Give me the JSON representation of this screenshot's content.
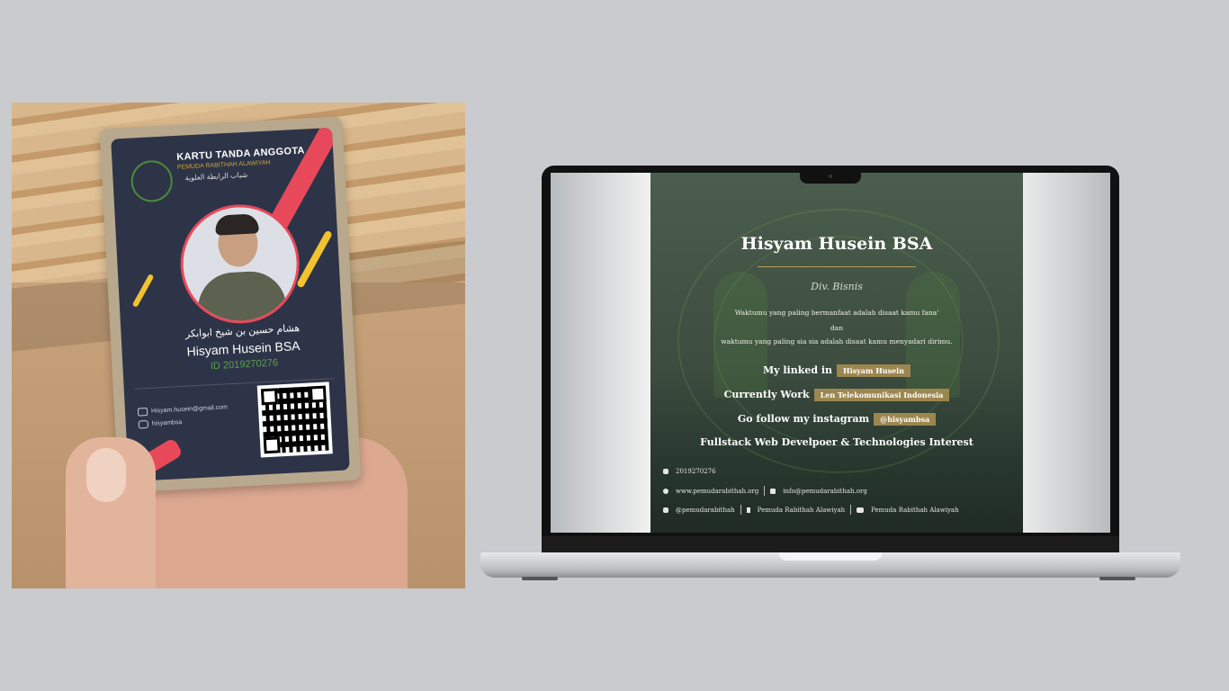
{
  "photo": {
    "card": {
      "title": "KARTU TANDA ANGGOTA",
      "org_latin": "PEMUDA RABITHAH ALAWIYAH",
      "org_arabic": "شباب الرابطة العلوية",
      "arabic_name": "هشام حسين بن شيخ ابوابكر",
      "name": "Hisyam Husein BSA",
      "id": "ID 2019270276",
      "email": "Hisyam.husein@gmail.com",
      "instagram": "hisyambsa"
    }
  },
  "page": {
    "name": "Hisyam Husein BSA",
    "division": "Div. Bisnis",
    "quote_line1": "Waktumu yang paling bermanfaat adalah disaat kamu fana'",
    "quote_and": "dan",
    "quote_line2": "waktumu yang paling sia sia adalah disaat kamu menyadari dirimu.",
    "linkedin_label": "My linked in",
    "linkedin_value": "Hisyam Husein",
    "work_label": "Currently Work",
    "work_value": "Len Telekomunikasi Indonesia",
    "instagram_label": "Go follow my instagram",
    "instagram_value": "@hisyambsa",
    "interest": "Fullstack Web Develpoer & Technologies Interest",
    "footer": {
      "member_id": "2019270276",
      "website": "www.pemudarabithah.org",
      "email": "info@pemudarabithah.org",
      "instagram": "@pemudarabithah",
      "facebook": "Pemuda Rabithah Alawiyah",
      "youtube": "Pemuda Rabithah Alawiyah"
    }
  },
  "colors": {
    "background": "#c9cbcf",
    "page_green": "#3c4c3f",
    "tag_gold": "#9c8650",
    "card_navy": "#2d3448",
    "accent_red": "#e8495a"
  }
}
